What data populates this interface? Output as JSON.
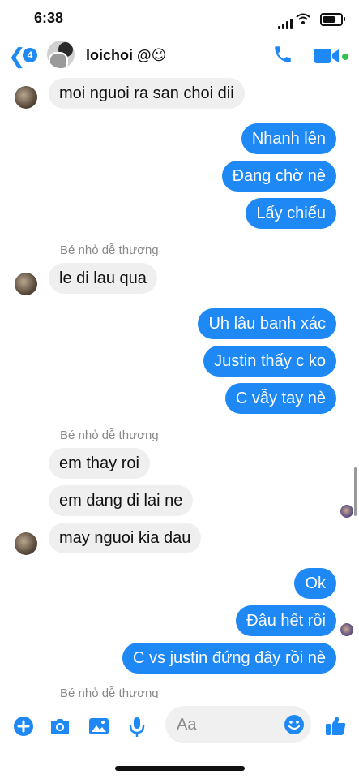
{
  "status": {
    "time": "6:38"
  },
  "header": {
    "back_count": "4",
    "name": "loichoi",
    "name_suffix": "@😉"
  },
  "messages": {
    "m1": "moi nguoi ra san choi dii",
    "m2": "Nhanh lên",
    "m3": "Đang chờ nè",
    "m4": "Lấy chiếu",
    "s1": "Bé nhỏ dễ thương",
    "m5": "le di lau qua",
    "m6": "Uh lâu banh xác",
    "m7": "Justin thấy c ko",
    "m8": "C vẫy tay nè",
    "s2": "Bé nhỏ dễ thương",
    "m9": "em thay roi",
    "m10": "em dang di lai ne",
    "m11": "may nguoi kia dau",
    "m12": "Ok",
    "m13": "Đâu hết rồi",
    "m14": "C vs justin đứng đây rồi nè",
    "s3": "Bé nhỏ dễ thương"
  },
  "composer": {
    "placeholder": "Aa"
  },
  "colors": {
    "accent": "#1e88f5",
    "incoming_bubble": "#efefef",
    "online": "#31c24d"
  },
  "icons": [
    "back-chevron-icon",
    "phone-icon",
    "video-camera-icon",
    "plus-icon",
    "camera-icon",
    "gallery-icon",
    "microphone-icon",
    "emoji-icon",
    "thumbs-up-icon"
  ]
}
